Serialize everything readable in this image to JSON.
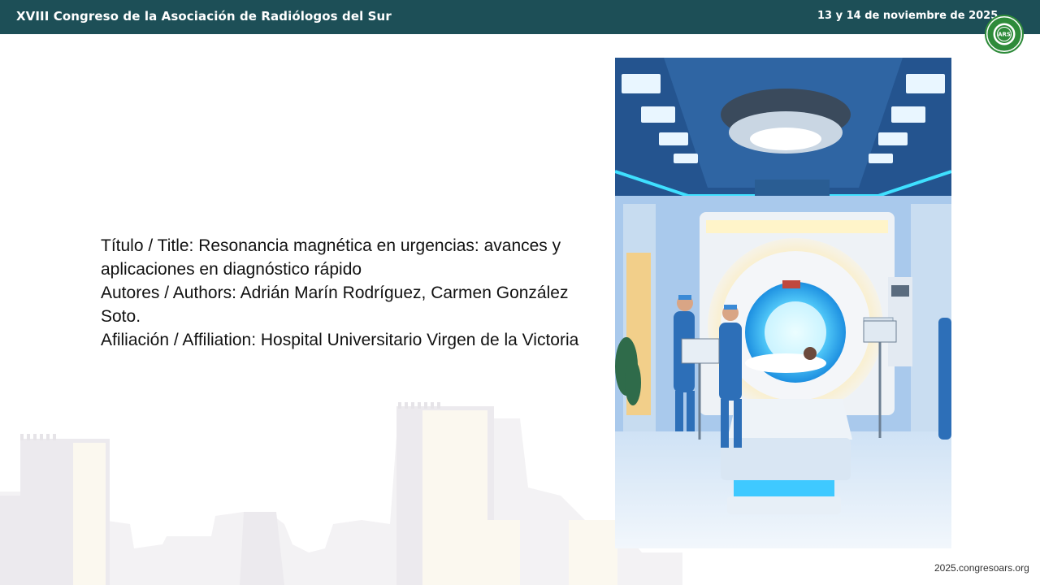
{
  "header": {
    "title": "XVIII Congreso de la Asociación de Radiólogos del Sur",
    "date": "13 y 14 de noviembre de 2025",
    "logo": {
      "center_text": "ARS",
      "ring_text": "ASOCIACIÓN RADIÓLOGOS SUR",
      "color": "#2e8b3a"
    },
    "background_color": "#1d4f57"
  },
  "presentation": {
    "title_line": "Título / Title: Resonancia magnética en urgencias: avances y aplicaciones en diagnóstico rápido",
    "authors_line": "Autores / Authors: Adrián Marín Rodríguez, Carmen González Soto.",
    "affiliation_line": "Afiliación / Affiliation: Hospital Universitario Virgen de la Victoria"
  },
  "hero_image": {
    "icon": "mri-room-illustration-icon"
  },
  "footer": {
    "url": "2025.congresoars.org"
  }
}
